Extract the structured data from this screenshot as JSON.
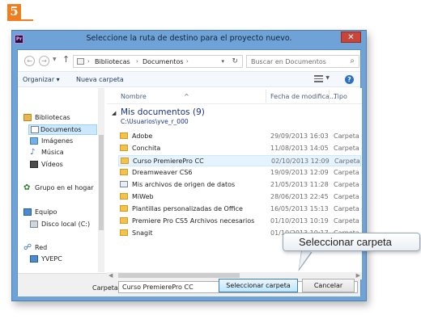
{
  "step": {
    "number": "5"
  },
  "window": {
    "title": "Seleccione la ruta de destino para el proyecto nuevo.",
    "app_icon_text": "Pr",
    "close_glyph": "✕"
  },
  "address": {
    "segments": [
      "Bibliotecas",
      "Documentos"
    ],
    "search_placeholder": "Buscar en Documentos"
  },
  "toolbar": {
    "organize_label": "Organizar ▾",
    "new_folder_label": "Nueva carpeta"
  },
  "nav": {
    "items": [
      {
        "label": "Bibliotecas",
        "icon": "library-icon"
      },
      {
        "label": "Documentos",
        "icon": "documents-icon",
        "selected": true
      },
      {
        "label": "Imágenes",
        "icon": "pictures-icon"
      },
      {
        "label": "Música",
        "icon": "music-icon"
      },
      {
        "label": "Vídeos",
        "icon": "videos-icon"
      },
      {
        "label": "Grupo en el hogar",
        "icon": "homegroup-icon"
      },
      {
        "label": "Equipo",
        "icon": "computer-icon"
      },
      {
        "label": "Disco local (C:)",
        "icon": "disk-icon"
      },
      {
        "label": "Red",
        "icon": "network-icon"
      },
      {
        "label": "YVEPC",
        "icon": "pc-icon"
      }
    ]
  },
  "columns": {
    "name": "Nombre",
    "date": "Fecha de modifica...",
    "type": "Tipo"
  },
  "group": {
    "title": "Mis documentos (9)",
    "path": "C:\\Usuarios\\yve_r_000"
  },
  "files": [
    {
      "name": "Adobe",
      "date": "29/09/2013 16:03",
      "type": "Carpeta c"
    },
    {
      "name": "Conchita",
      "date": "11/08/2013 14:05",
      "type": "Carpeta c"
    },
    {
      "name": "Curso PremierePro CC",
      "date": "02/10/2013 12:09",
      "type": "Carpeta c",
      "selected": true
    },
    {
      "name": "Dreamweaver CS6",
      "date": "19/09/2013 12:09",
      "type": "Carpeta c"
    },
    {
      "name": "Mis archivos de origen de datos",
      "date": "21/05/2013 11:28",
      "type": "Carpeta c",
      "icon": "data-sources-icon"
    },
    {
      "name": "MiWeb",
      "date": "28/06/2013 22:45",
      "type": "Carpeta c"
    },
    {
      "name": "Plantillas personalizadas de Office",
      "date": "16/05/2013 15:13",
      "type": "Carpeta c"
    },
    {
      "name": "Premiere Pro CS5 Archivos necesarios",
      "date": "01/10/2013 10:19",
      "type": "Carpeta c"
    },
    {
      "name": "Snagit",
      "date": "01/10/2013 10:17",
      "type": "Carpeta c"
    }
  ],
  "footer": {
    "folder_label": "Carpeta:",
    "folder_value": "Curso PremierePro CC",
    "select_button": "Seleccionar carpeta",
    "cancel_button": "Cancelar"
  },
  "callout": {
    "text": "Seleccionar carpeta"
  },
  "colors": {
    "accent": "#f07e1f",
    "window_frame": "#6fa3d7",
    "close": "#c9453a",
    "group_text": "#1e3287"
  }
}
